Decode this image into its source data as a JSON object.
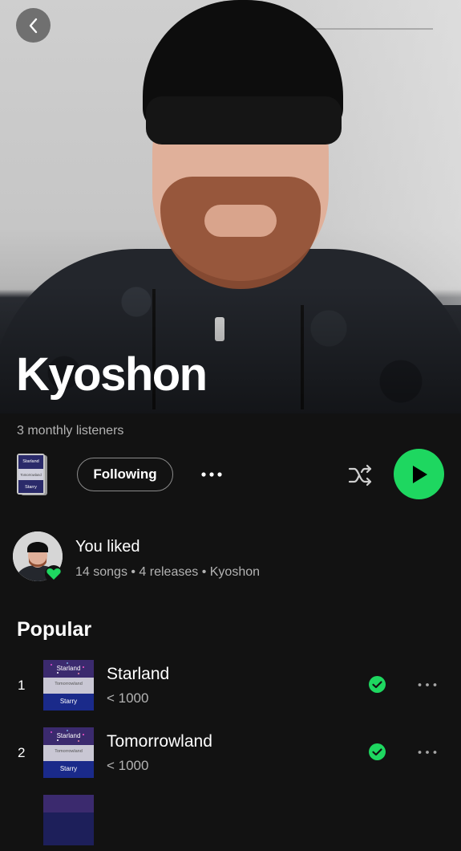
{
  "artist": {
    "name": "Kyoshon",
    "monthly_listeners": "3 monthly listeners"
  },
  "actions": {
    "following_label": "Following"
  },
  "liked": {
    "title": "You liked",
    "subtitle": "14 songs • 4 releases • Kyoshon"
  },
  "popular": {
    "title": "Popular",
    "tracks": [
      {
        "number": "1",
        "title": "Starland",
        "plays": "< 1000"
      },
      {
        "number": "2",
        "title": "Tomorrowland",
        "plays": "< 1000"
      }
    ]
  },
  "cover_art": {
    "label_top": "Starland",
    "label_mid": "Tomorrowland",
    "label_bottom": "Starry"
  },
  "icons": {
    "back": "chevron-left-icon",
    "more": "more-horizontal-icon",
    "shuffle": "shuffle-icon",
    "play": "play-icon",
    "liked": "heart-icon",
    "downloaded": "check-circle-icon"
  },
  "colors": {
    "accent": "#1ed760",
    "background": "#121212",
    "secondary_text": "#b3b3b3"
  }
}
